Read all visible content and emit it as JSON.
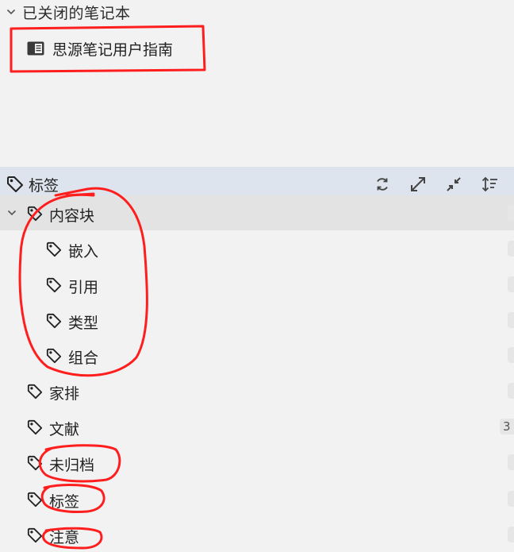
{
  "closed_notebooks": {
    "title": "已关闭的笔记本",
    "items": [
      {
        "label": "思源笔记用户指南"
      }
    ]
  },
  "tags_panel": {
    "title": "标签",
    "actions": [
      "refresh-icon",
      "expand-icon",
      "collapse-icon",
      "sort-icon"
    ],
    "tree": [
      {
        "label": "内容块",
        "expanded": true,
        "selected": true,
        "children": [
          {
            "label": "嵌入"
          },
          {
            "label": "引用"
          },
          {
            "label": "类型"
          },
          {
            "label": "组合"
          }
        ]
      },
      {
        "label": "家排"
      },
      {
        "label": "文献",
        "count": "3"
      },
      {
        "label": "未归档"
      },
      {
        "label": "标签"
      },
      {
        "label": "注意"
      }
    ]
  },
  "colors": {
    "panel_bg": "#f2f2f2",
    "header_bg": "#dde4ee",
    "selected_bg": "#e3e3e3",
    "annotation_red": "#ff1e1e"
  }
}
